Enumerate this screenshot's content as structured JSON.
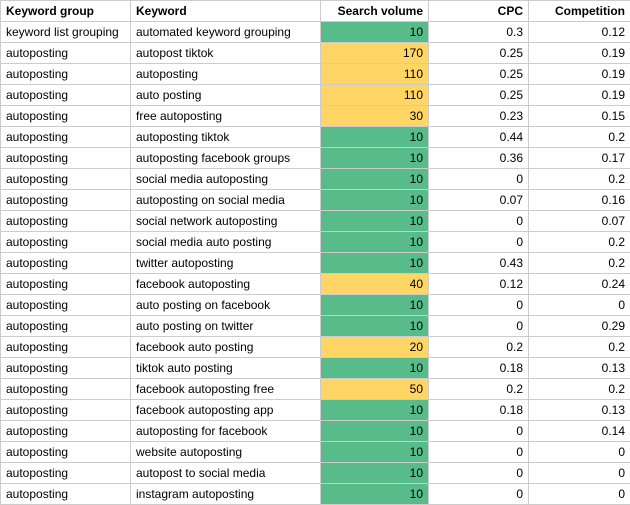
{
  "columns": {
    "group": "Keyword group",
    "keyword": "Keyword",
    "volume": "Search volume",
    "cpc": "CPC",
    "competition": "Competition"
  },
  "rows": [
    {
      "group": "keyword list grouping",
      "keyword": "automated keyword grouping",
      "volume": 10,
      "vol_color": "green",
      "cpc": "0.3",
      "competition": "0.12"
    },
    {
      "group": "autoposting",
      "keyword": "autopost tiktok",
      "volume": 170,
      "vol_color": "yellow",
      "cpc": "0.25",
      "competition": "0.19"
    },
    {
      "group": "autoposting",
      "keyword": "autoposting",
      "volume": 110,
      "vol_color": "yellow",
      "cpc": "0.25",
      "competition": "0.19"
    },
    {
      "group": "autoposting",
      "keyword": "auto posting",
      "volume": 110,
      "vol_color": "yellow",
      "cpc": "0.25",
      "competition": "0.19"
    },
    {
      "group": "autoposting",
      "keyword": "free autoposting",
      "volume": 30,
      "vol_color": "yellow",
      "cpc": "0.23",
      "competition": "0.15"
    },
    {
      "group": "autoposting",
      "keyword": "autoposting tiktok",
      "volume": 10,
      "vol_color": "green",
      "cpc": "0.44",
      "competition": "0.2"
    },
    {
      "group": "autoposting",
      "keyword": "autoposting facebook groups",
      "volume": 10,
      "vol_color": "green",
      "cpc": "0.36",
      "competition": "0.17"
    },
    {
      "group": "autoposting",
      "keyword": "social media autoposting",
      "volume": 10,
      "vol_color": "green",
      "cpc": "0",
      "competition": "0.2"
    },
    {
      "group": "autoposting",
      "keyword": "autoposting on social media",
      "volume": 10,
      "vol_color": "green",
      "cpc": "0.07",
      "competition": "0.16"
    },
    {
      "group": "autoposting",
      "keyword": "social network autoposting",
      "volume": 10,
      "vol_color": "green",
      "cpc": "0",
      "competition": "0.07"
    },
    {
      "group": "autoposting",
      "keyword": "social media auto posting",
      "volume": 10,
      "vol_color": "green",
      "cpc": "0",
      "competition": "0.2"
    },
    {
      "group": "autoposting",
      "keyword": "twitter autoposting",
      "volume": 10,
      "vol_color": "green",
      "cpc": "0.43",
      "competition": "0.2"
    },
    {
      "group": "autoposting",
      "keyword": "facebook autoposting",
      "volume": 40,
      "vol_color": "yellow",
      "cpc": "0.12",
      "competition": "0.24"
    },
    {
      "group": "autoposting",
      "keyword": "auto posting on facebook",
      "volume": 10,
      "vol_color": "green",
      "cpc": "0",
      "competition": "0"
    },
    {
      "group": "autoposting",
      "keyword": "auto posting on twitter",
      "volume": 10,
      "vol_color": "green",
      "cpc": "0",
      "competition": "0.29"
    },
    {
      "group": "autoposting",
      "keyword": "facebook auto posting",
      "volume": 20,
      "vol_color": "yellow",
      "cpc": "0.2",
      "competition": "0.2"
    },
    {
      "group": "autoposting",
      "keyword": "tiktok auto posting",
      "volume": 10,
      "vol_color": "green",
      "cpc": "0.18",
      "competition": "0.13"
    },
    {
      "group": "autoposting",
      "keyword": "facebook autoposting free",
      "volume": 50,
      "vol_color": "yellow",
      "cpc": "0.2",
      "competition": "0.2"
    },
    {
      "group": "autoposting",
      "keyword": "facebook autoposting app",
      "volume": 10,
      "vol_color": "green",
      "cpc": "0.18",
      "competition": "0.13"
    },
    {
      "group": "autoposting",
      "keyword": "autoposting for facebook",
      "volume": 10,
      "vol_color": "green",
      "cpc": "0",
      "competition": "0.14"
    },
    {
      "group": "autoposting",
      "keyword": "website autoposting",
      "volume": 10,
      "vol_color": "green",
      "cpc": "0",
      "competition": "0"
    },
    {
      "group": "autoposting",
      "keyword": "autopost to social media",
      "volume": 10,
      "vol_color": "green",
      "cpc": "0",
      "competition": "0"
    },
    {
      "group": "autoposting",
      "keyword": "instagram autoposting",
      "volume": 10,
      "vol_color": "green",
      "cpc": "0",
      "competition": "0"
    }
  ]
}
